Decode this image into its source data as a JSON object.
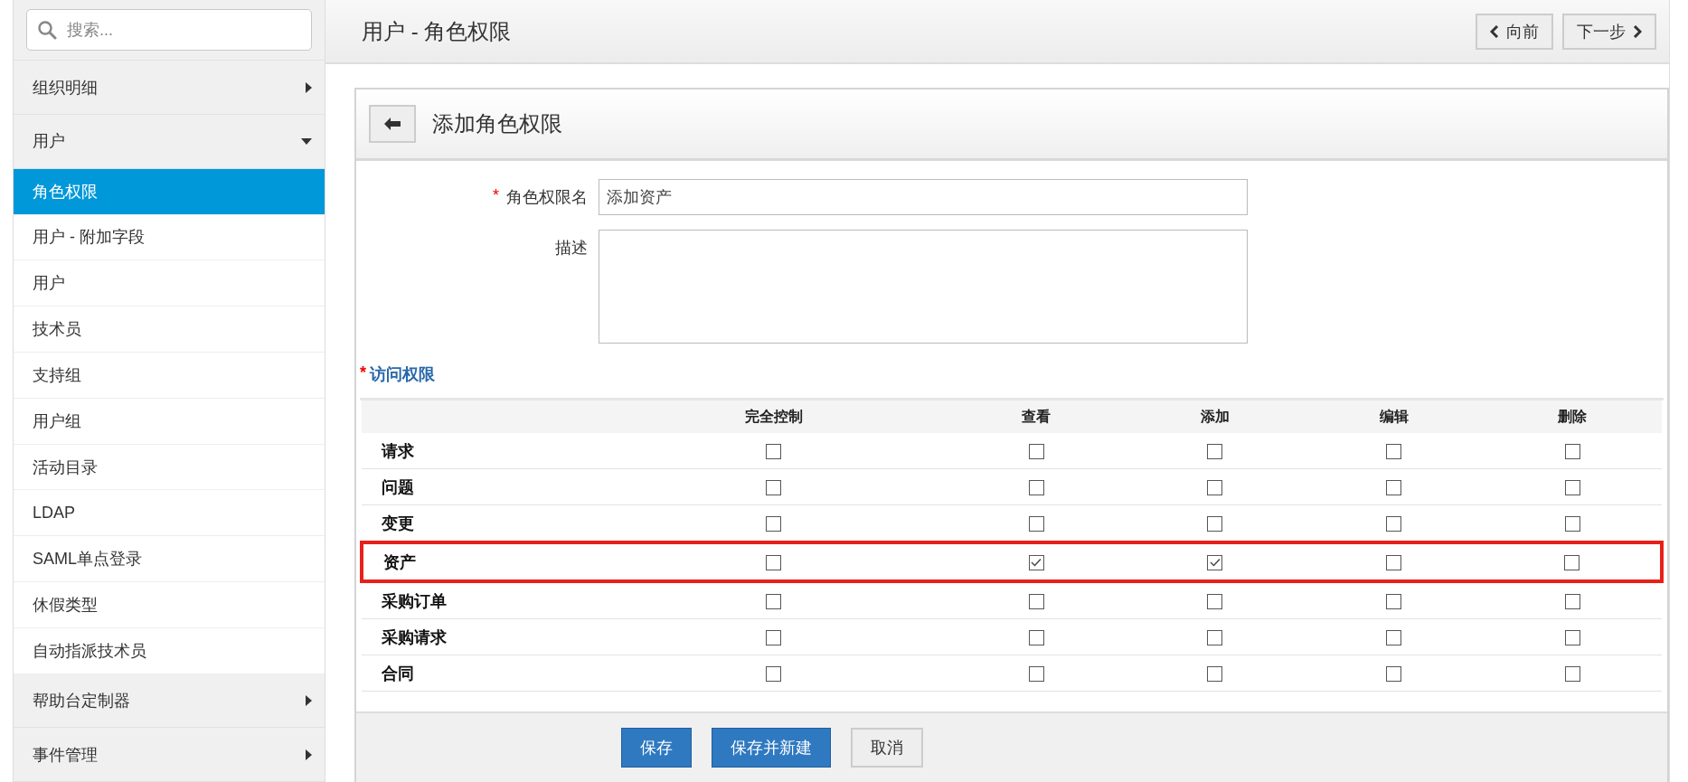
{
  "sidebar": {
    "search": {
      "placeholder": "搜索..."
    },
    "items": [
      {
        "label": "组织明细",
        "expanded": false
      },
      {
        "label": "用户",
        "expanded": true,
        "children": [
          {
            "label": "角色权限",
            "selected": true
          },
          {
            "label": "用户 - 附加字段",
            "selected": false
          },
          {
            "label": "用户",
            "selected": false
          },
          {
            "label": "技术员",
            "selected": false
          },
          {
            "label": "支持组",
            "selected": false
          },
          {
            "label": "用户组",
            "selected": false
          },
          {
            "label": "活动目录",
            "selected": false
          },
          {
            "label": "LDAP",
            "selected": false
          },
          {
            "label": "SAML单点登录",
            "selected": false
          },
          {
            "label": "休假类型",
            "selected": false
          },
          {
            "label": "自动指派技术员",
            "selected": false
          }
        ]
      },
      {
        "label": "帮助台定制器",
        "expanded": false
      },
      {
        "label": "事件管理",
        "expanded": false
      }
    ]
  },
  "header": {
    "title": "用户 - 角色权限",
    "prev_button": "向前",
    "next_button": "下一步"
  },
  "panel": {
    "title": "添加角色权限",
    "name_field": {
      "required_mark": "*",
      "label": "角色权限名",
      "value": "添加资产"
    },
    "description_field": {
      "label": "描述"
    },
    "access": {
      "required_mark": "*",
      "title": "访问权限",
      "columns": [
        "完全控制",
        "查看",
        "添加",
        "编辑",
        "删除"
      ],
      "rows": [
        {
          "label": "请求",
          "checked": [
            false,
            false,
            false,
            false,
            false
          ],
          "highlighted": false
        },
        {
          "label": "问题",
          "checked": [
            false,
            false,
            false,
            false,
            false
          ],
          "highlighted": false
        },
        {
          "label": "变更",
          "checked": [
            false,
            false,
            false,
            false,
            false
          ],
          "highlighted": false
        },
        {
          "label": "资产",
          "checked": [
            false,
            true,
            true,
            false,
            false
          ],
          "highlighted": true
        },
        {
          "label": "采购订单",
          "checked": [
            false,
            false,
            false,
            false,
            false
          ],
          "highlighted": false
        },
        {
          "label": "采购请求",
          "checked": [
            false,
            false,
            false,
            false,
            false
          ],
          "highlighted": false
        },
        {
          "label": "合同",
          "checked": [
            false,
            false,
            false,
            false,
            false
          ],
          "highlighted": false
        }
      ]
    },
    "buttons": [
      {
        "label": "保存",
        "kind": "primary"
      },
      {
        "label": "保存并新建",
        "kind": "primary"
      },
      {
        "label": "取消",
        "kind": "secondary"
      }
    ]
  }
}
